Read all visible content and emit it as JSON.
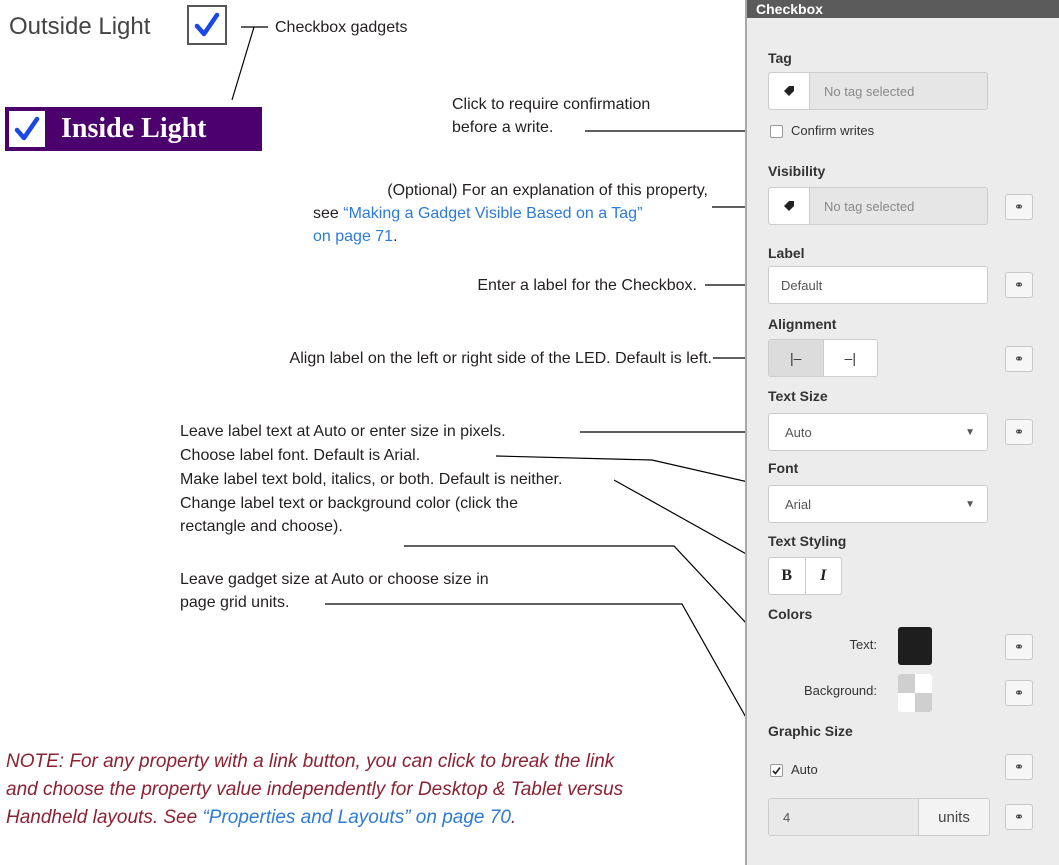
{
  "preview": {
    "outside_label": "Outside Light",
    "inside_label": "Inside Light",
    "caption": "Checkbox gadgets"
  },
  "annotations": {
    "confirm_1": "Click to require confirmation",
    "confirm_2": "before a write.",
    "visibility_1": "(Optional) For an explanation of this property,",
    "visibility_2_prefix": "see ",
    "visibility_2_link": "“Making a Gadget Visible Based on a Tag”",
    "visibility_3_link": "on page 71",
    "visibility_3_suffix": ".",
    "label": "Enter a label for the Checkbox.",
    "alignment": "Align label on the left or right side of the LED. Default is left.",
    "text_size": "Leave label text at Auto or enter size in pixels.",
    "font": "Choose label font. Default is Arial.",
    "text_styling": "Make label text bold, italics, or both. Default is neither.",
    "colors_1": "Change label text or background color (click the",
    "colors_2": "rectangle and choose).",
    "graphic_1": "Leave gadget size at Auto or choose size in",
    "graphic_2": "page grid units."
  },
  "note": {
    "line1": "NOTE: For any property with a link button, you can click to break the link",
    "line2": "and choose the property value independently for Desktop & Tablet versus",
    "line3_prefix": "Handheld layouts. See ",
    "line3_link": "“Properties and Layouts” on page 70",
    "line3_suffix": "."
  },
  "panel": {
    "title": "Checkbox",
    "tag_label": "Tag",
    "tag_placeholder": "No tag selected",
    "confirm_writes": "Confirm writes",
    "visibility_label": "Visibility",
    "visibility_placeholder": "No tag selected",
    "label_label": "Label",
    "label_value": "Default",
    "alignment_label": "Alignment",
    "align_left_glyph": "|–",
    "align_right_glyph": "–|",
    "text_size_label": "Text Size",
    "text_size_value": "Auto",
    "font_label": "Font",
    "font_value": "Arial",
    "text_styling_label": "Text Styling",
    "bold_glyph": "B",
    "italic_glyph": "I",
    "colors_label": "Colors",
    "text_color_label": "Text:",
    "background_color_label": "Background:",
    "graphic_size_label": "Graphic Size",
    "auto_label": "Auto",
    "units_value": "4",
    "units_label": "units",
    "text_color": "#1e1e1e",
    "checkmark_color": "#1a47e8"
  }
}
